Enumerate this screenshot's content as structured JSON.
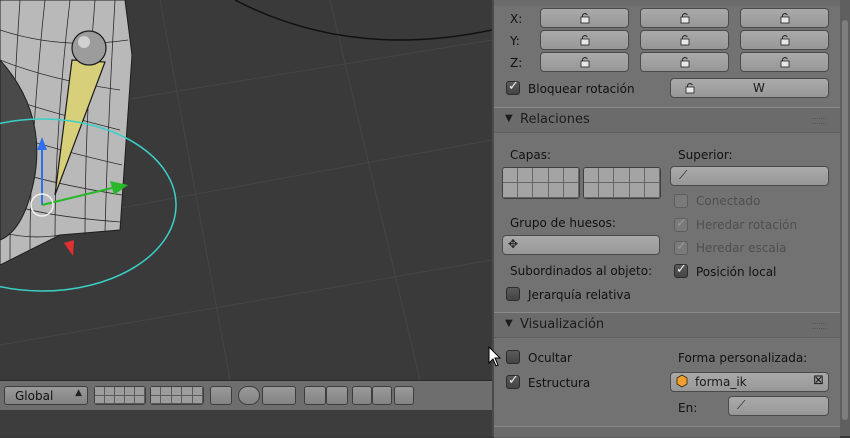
{
  "transform_locks": {
    "rows": [
      {
        "axis": "X:"
      },
      {
        "axis": "Y:"
      },
      {
        "axis": "Z:"
      }
    ],
    "lock_rotation_label": "Bloquear rotación",
    "lock_rotation_checked": true,
    "rotation_mode_value": "W"
  },
  "relations": {
    "title": "Relaciones",
    "layers_label": "Capas:",
    "parent_label": "Superior:",
    "connected_label": "Conectado",
    "inherit_rotation_label": "Heredar rotación",
    "inherit_scale_label": "Heredar escala",
    "local_location_label": "Posición local",
    "bone_group_label": "Grupo de huesos:",
    "object_children_label": "Subordinados al objeto:",
    "relative_parenting_label": "Jerarquía relativa"
  },
  "display": {
    "title": "Visualización",
    "hide_label": "Ocultar",
    "wire_label": "Estructura",
    "custom_shape_label": "Forma personalizada:",
    "custom_shape_value": "forma_ik",
    "at_label": "En:"
  },
  "viewport_header": {
    "orientation_value": "Global"
  },
  "icons": {
    "lock": "lock-icon",
    "bone": "bone-icon",
    "group": "bone-group-icon",
    "object": "object-icon",
    "clear": "clear-icon"
  },
  "colors": {
    "panel_bg": "#727272",
    "viewport_bg": "#3a3a3a",
    "circle": "#3ad0c8",
    "bone": "#d8cf7a",
    "axis_x": "#e03030",
    "axis_y": "#29b829",
    "axis_z": "#2f6ff0"
  }
}
